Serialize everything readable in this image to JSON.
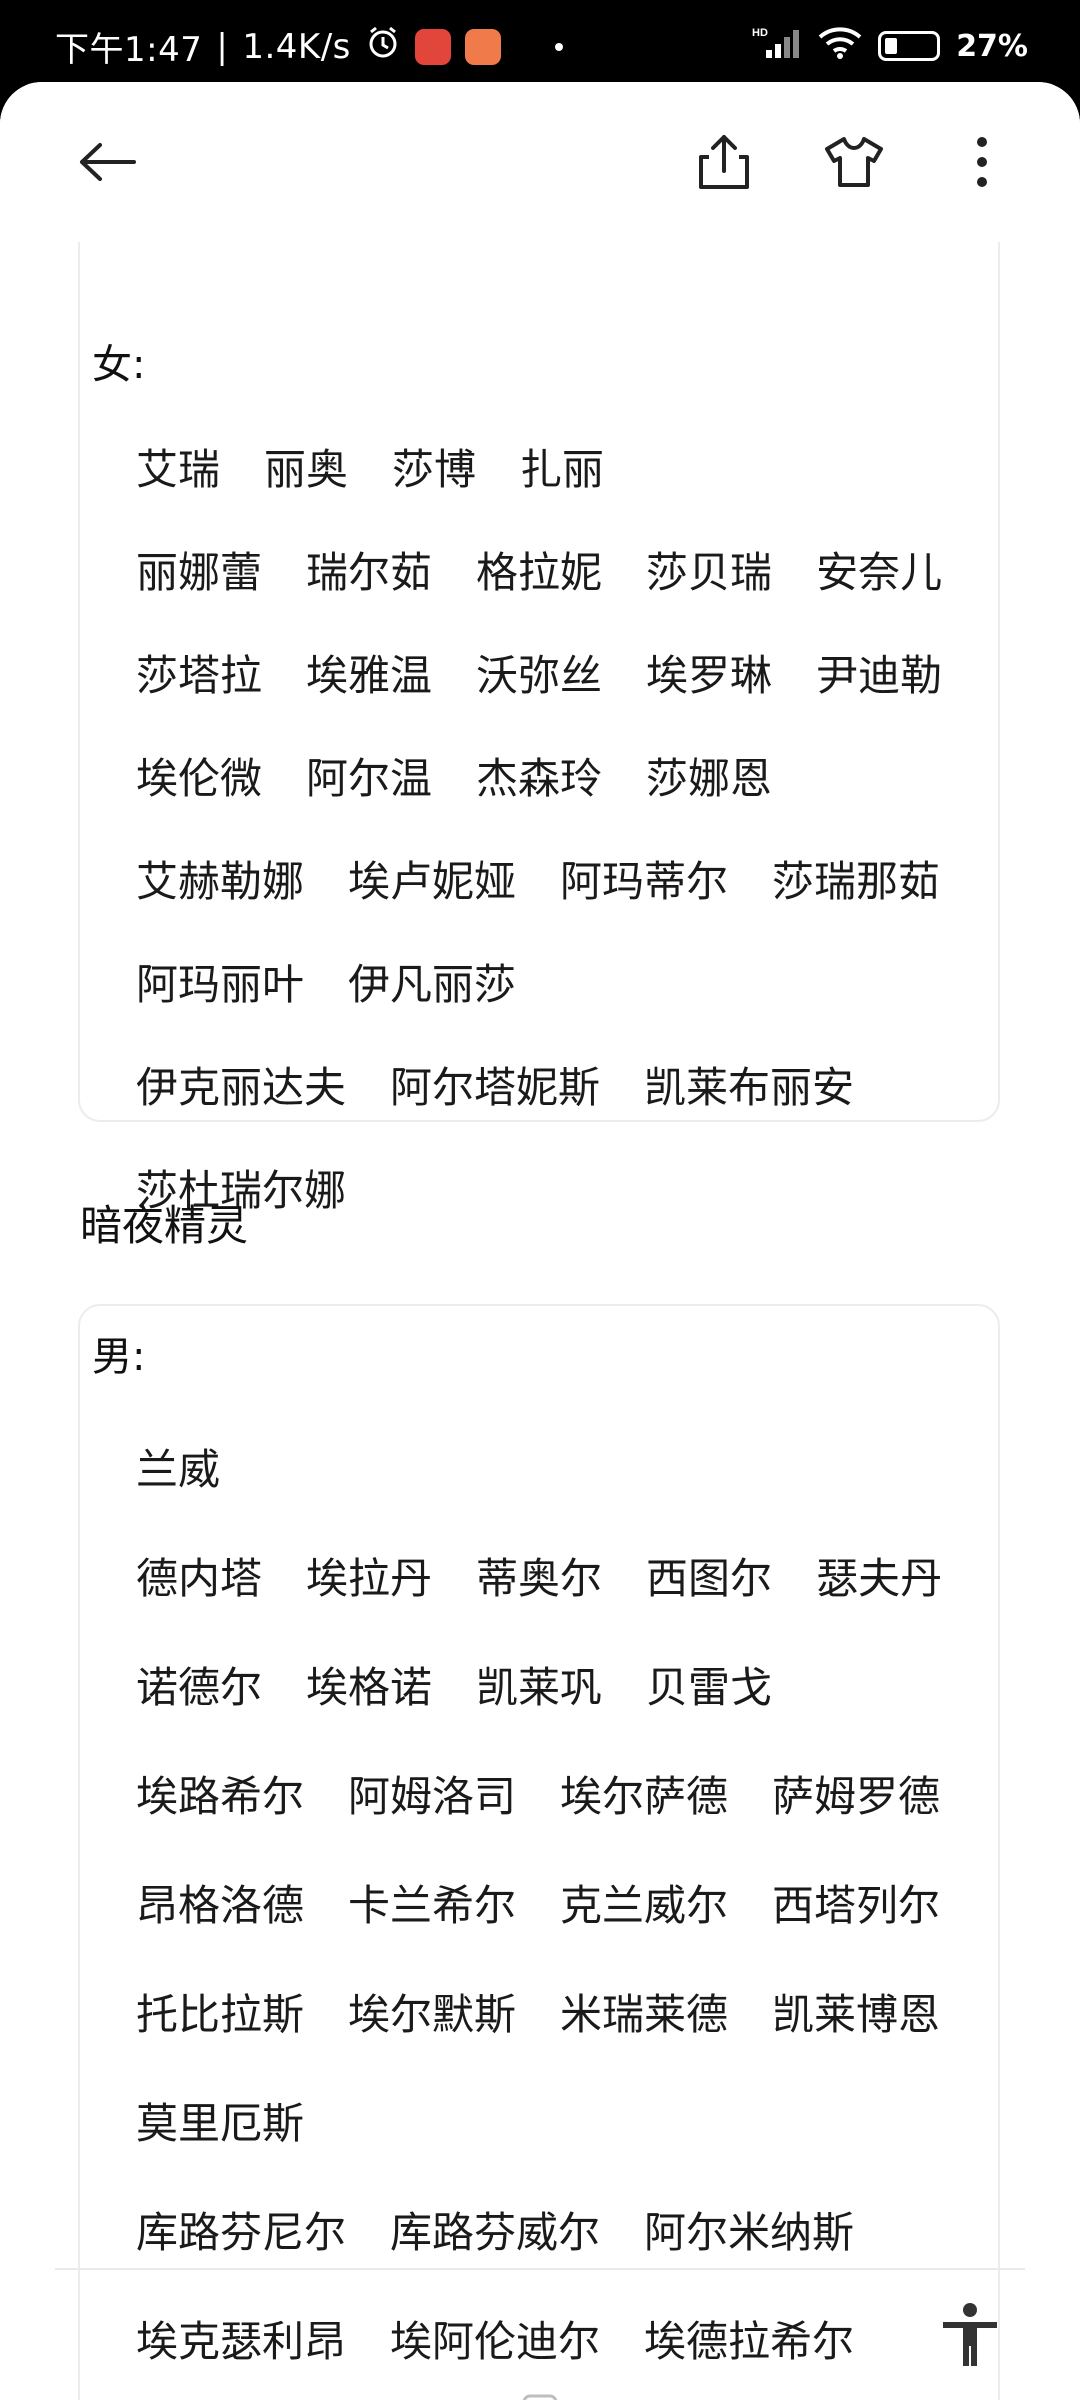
{
  "status_bar": {
    "time": "下午1:47",
    "network_speed": "1.4K/s",
    "battery_percent_text": "27%",
    "battery_level": 0.27,
    "signal_label": "HD"
  },
  "toolbar": {
    "back_icon": "arrow-left-icon",
    "share_icon": "share-icon",
    "theme_icon": "tshirt-icon",
    "more_icon": "more-vertical-icon"
  },
  "female_card": {
    "label": "女:",
    "lines": [
      [
        "艾瑞",
        "丽奥",
        "莎博",
        "扎丽"
      ],
      [
        "丽娜蕾",
        "瑞尔茹",
        "格拉妮",
        "莎贝瑞",
        "安奈儿"
      ],
      [
        "莎塔拉",
        "埃雅温",
        "沃弥丝",
        "埃罗琳",
        "尹迪勒"
      ],
      [
        "埃伦微",
        "阿尔温",
        "杰森玲",
        "莎娜恩"
      ],
      [
        "艾赫勒娜",
        "埃卢妮娅",
        "阿玛蒂尔",
        "莎瑞那茹"
      ],
      [
        "阿玛丽叶",
        "伊凡丽莎"
      ],
      [
        "伊克丽达夫",
        "阿尔塔妮斯",
        "凯莱布丽安"
      ],
      [
        "莎杜瑞尔娜"
      ]
    ]
  },
  "dark_elf_section": {
    "heading": "暗夜精灵"
  },
  "male_card": {
    "label": "男:",
    "lines": [
      [
        "兰威"
      ],
      [
        "德内塔",
        "埃拉丹",
        "蒂奥尔",
        "西图尔",
        "瑟夫丹"
      ],
      [
        "诺德尔",
        "埃格诺",
        "凯莱巩",
        "贝雷戈"
      ],
      [
        "埃路希尔",
        "阿姆洛司",
        "埃尔萨德",
        "萨姆罗德"
      ],
      [
        "昂格洛德",
        "卡兰希尔",
        "克兰威尔",
        "西塔列尔"
      ],
      [
        "托比拉斯",
        "埃尔默斯",
        "米瑞莱德",
        "凯莱博恩"
      ],
      [
        "莫里厄斯"
      ],
      [
        "库路芬尼尔",
        "库路芬威尔",
        "阿尔米纳斯"
      ],
      [
        "埃克瑟利昂",
        "埃阿伦迪尔",
        "埃德拉希尔"
      ]
    ]
  },
  "colors": {
    "background": "#ffffff",
    "status_bar": "#000000",
    "text": "#1a1a1a",
    "card_border": "#ececec"
  }
}
